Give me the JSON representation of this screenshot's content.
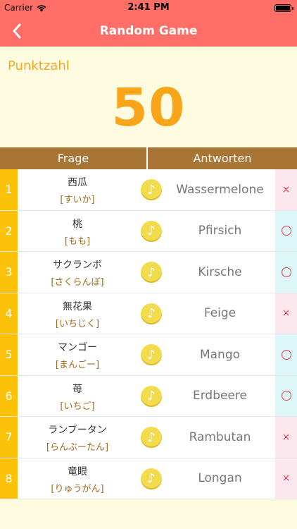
{
  "status": {
    "carrier": "Carrier",
    "time": "2:41 PM"
  },
  "nav": {
    "title": "Random Game",
    "back_icon": "chevron-left-icon"
  },
  "score": {
    "label": "Punktzahl",
    "value": "50"
  },
  "table": {
    "headers": {
      "question": "Frage",
      "answers": "Antworten"
    },
    "rows": [
      {
        "num": "1",
        "kanji": "西瓜",
        "kana": "[すいか]",
        "answer": "Wassermelone",
        "result": "wrong",
        "mark": "×"
      },
      {
        "num": "2",
        "kanji": "桃",
        "kana": "[もも]",
        "answer": "Pfirsich",
        "result": "right",
        "mark": "○"
      },
      {
        "num": "3",
        "kanji": "サクランボ",
        "kana": "[さくらんぼ]",
        "answer": "Kirsche",
        "result": "right",
        "mark": "○"
      },
      {
        "num": "4",
        "kanji": "無花果",
        "kana": "[いちじく]",
        "answer": "Feige",
        "result": "wrong",
        "mark": "×"
      },
      {
        "num": "5",
        "kanji": "マンゴー",
        "kana": "[まんごー]",
        "answer": "Mango",
        "result": "right",
        "mark": "○"
      },
      {
        "num": "6",
        "kanji": "苺",
        "kana": "[いちご]",
        "answer": "Erdbeere",
        "result": "right",
        "mark": "○"
      },
      {
        "num": "7",
        "kanji": "ランブータン",
        "kana": "[らんぶーたん]",
        "answer": "Rambutan",
        "result": "wrong",
        "mark": "×"
      },
      {
        "num": "8",
        "kanji": "竜眼",
        "kana": "[りゅうがん]",
        "answer": "Longan",
        "result": "wrong",
        "mark": "×"
      }
    ]
  },
  "colors": {
    "accent": "#ff6f67",
    "score": "#f9a51a",
    "header": "#a87534",
    "number_column": "#fcc209"
  }
}
